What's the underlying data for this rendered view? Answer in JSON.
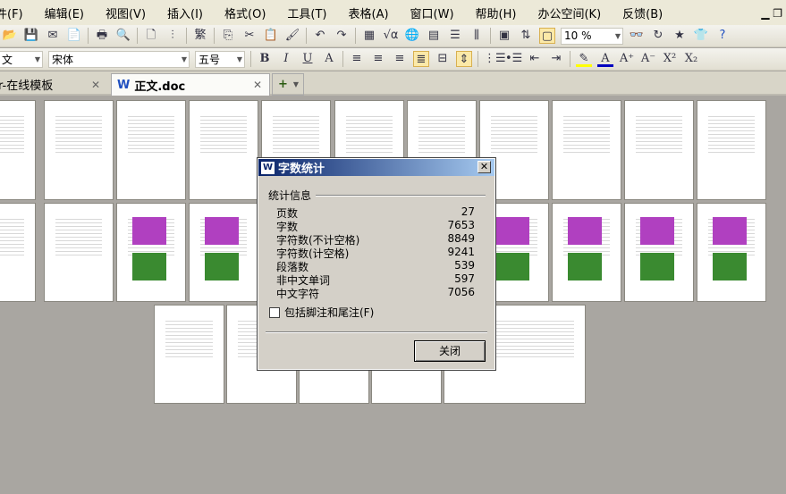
{
  "menu": [
    "文件(F)",
    "编辑(E)",
    "视图(V)",
    "插入(I)",
    "格式(O)",
    "工具(T)",
    "表格(A)",
    "窗口(W)",
    "帮助(H)",
    "办公空间(K)",
    "反馈(B)"
  ],
  "toolbar": {
    "traditional": "繁",
    "zoom": "10 %",
    "style": "文",
    "font": "宋体",
    "size": "五号",
    "bold": "B",
    "italic": "I",
    "underline": "U",
    "fontcolor": "A",
    "grow": "A⁺",
    "shrink": "A⁻",
    "sup": "X²",
    "sub": "X₂"
  },
  "tabs": [
    {
      "label": "r-在线模板"
    },
    {
      "label": "正文.doc"
    }
  ],
  "tab_add": "+",
  "dialog": {
    "title": "字数统计",
    "group": "统计信息",
    "stats": [
      {
        "label": "页数",
        "value": "27"
      },
      {
        "label": "字数",
        "value": "7653"
      },
      {
        "label": "字符数(不计空格)",
        "value": "8849"
      },
      {
        "label": "字符数(计空格)",
        "value": "9241"
      },
      {
        "label": "段落数",
        "value": "539"
      },
      {
        "label": "非中文单词",
        "value": "597"
      },
      {
        "label": "中文字符",
        "value": "7056"
      }
    ],
    "checkbox": "包括脚注和尾注(F)",
    "close": "关闭"
  }
}
